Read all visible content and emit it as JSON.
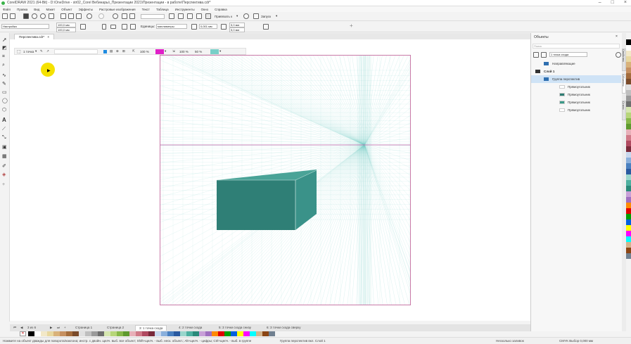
{
  "window": {
    "title": "CorelDRAW 2021 (64-Bit) - D:\\OneDrive - str02_Corel Вебинары\\_Презентации 2021\\Презентации - в работе\\Перспектива.cdr*",
    "controls": [
      "–",
      "□",
      "×"
    ]
  },
  "menu": [
    "Файл",
    "Правка",
    "Вид",
    "Макет",
    "Объект",
    "Эффекты",
    "Растровые изображения",
    "Текст",
    "Таблица",
    "Инструменты",
    "Окно",
    "Справка"
  ],
  "toolbar1": {
    "snap_label": "Привязать к",
    "launch_label": "Запуск"
  },
  "toolbar2": {
    "preset": "Настройка",
    "width": "100,0 мм",
    "height": "100,0 мм",
    "units_label": "Единицы:",
    "units_value": "миллиметры",
    "nudge": "0,001 мм",
    "dup_x": "5,0 мм",
    "dup_y": "5,0 мм"
  },
  "document_tab": "Перспектива.cdr*",
  "perspective_bar": {
    "mode": "1 точка",
    "opacity1": "100 %",
    "opacity2": "100 %",
    "opacity3": "50 %",
    "color1": "#e020c8",
    "color2": "#78cfc8"
  },
  "page_tabs": {
    "counter": "3 из 6",
    "tabs": [
      "Страница 1",
      "Страница 2",
      "3: 1 точка схода",
      "4: 2 точки схода",
      "5: 3 точки схода снизу",
      "6: 3 точки схода сверху"
    ],
    "active_index": 2
  },
  "statusbar": {
    "hint": "Нажмите на объект дважды для поворота/наклона; инстр. с двойн. щелч. выб. все объект; Shift+щелч. - выб. неск. объект.; Alt+щелч. - цифры; Ctrl+щелч. - выб. в группе",
    "object": "Группа перспектив вкл. Слой 1",
    "fill": "Несколько заливок",
    "outline": "CMYK Выбор 0,000 мм"
  },
  "objects_panel": {
    "title": "Объекты",
    "search_placeholder": "Поиск",
    "view_mode": "1 точка схода",
    "rows": [
      {
        "label": "Направляющие",
        "level": 1
      },
      {
        "label": "Слой 1",
        "level": 0,
        "bold": true
      },
      {
        "label": "Группа перспектив",
        "level": 1,
        "selected": true
      },
      {
        "label": "Прямоугольник",
        "level": 2,
        "swatch": "#ffffff"
      },
      {
        "label": "Прямоугольник",
        "level": 2,
        "swatch": "#2e7d73"
      },
      {
        "label": "Прямоугольник",
        "level": 2,
        "swatch": "#3a9a88"
      },
      {
        "label": "Прямоугольник",
        "level": 2,
        "swatch": "#ffffff"
      }
    ],
    "side_tabs": [
      "Свойства",
      "Объекты",
      "Стили"
    ]
  },
  "colors": {
    "page_border": "#c97aa8",
    "grid_line": "#7ccfca",
    "horizon": "#c060a8",
    "box_front": "#2f7f76",
    "box_top": "#4aa397",
    "box_side": "#3a9289"
  },
  "palette": [
    "#000000",
    "#ffffff",
    "#f2e8c8",
    "#e8d8a0",
    "#d9b27a",
    "#c69060",
    "#a46c3c",
    "#7a4b2a",
    "#e0e0e0",
    "#bfbfbf",
    "#9a9a9a",
    "#6e6e6e",
    "#d6e7b0",
    "#b7d67a",
    "#87b84a",
    "#5e9a2e",
    "#e7b0b8",
    "#d07a88",
    "#b04a60",
    "#7a2a3a",
    "#c8d8ee",
    "#8ab0dc",
    "#4a80c0",
    "#2a5aa0",
    "#9ad6cc",
    "#4eb0a0",
    "#2a8a7a",
    "#c8a0d8",
    "#a070c0",
    "#ff8a00",
    "#e00000",
    "#00a000",
    "#0060e0",
    "#ffff00",
    "#ff00ff",
    "#00ffff",
    "#d2b48c",
    "#8b4513",
    "#708090"
  ]
}
